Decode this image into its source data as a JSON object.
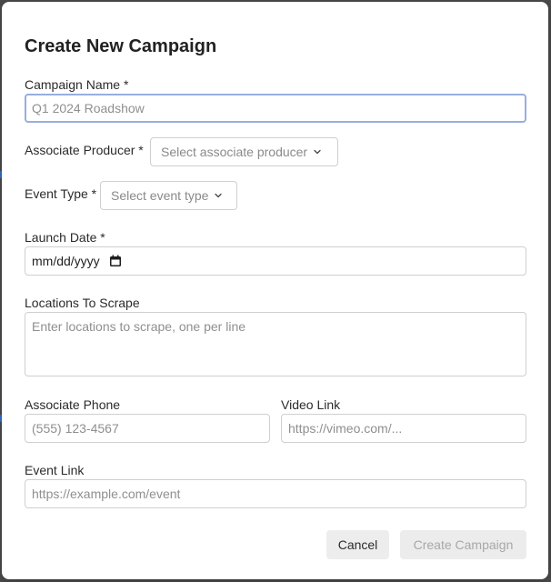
{
  "modal": {
    "title": "Create New Campaign"
  },
  "fields": {
    "campaign_name": {
      "label": "Campaign Name *",
      "placeholder": "Q1 2024 Roadshow"
    },
    "associate_producer": {
      "label": "Associate Producer *",
      "placeholder": "Select associate producer"
    },
    "event_type": {
      "label": "Event Type *",
      "placeholder": "Select event type"
    },
    "launch_date": {
      "label": "Launch Date *",
      "value": "mm/dd/yyyy"
    },
    "locations": {
      "label": "Locations To Scrape",
      "placeholder": "Enter locations to scrape, one per line"
    },
    "associate_phone": {
      "label": "Associate Phone",
      "placeholder": "(555) 123-4567"
    },
    "video_link": {
      "label": "Video Link",
      "placeholder": "https://vimeo.com/..."
    },
    "event_link": {
      "label": "Event Link",
      "placeholder": "https://example.com/event"
    }
  },
  "actions": {
    "cancel_label": "Cancel",
    "create_label": "Create Campaign"
  },
  "colors": {
    "focus_border": "#98aede",
    "disabled_text": "#a8a8a8",
    "backdrop": "#4b4b4b"
  },
  "icons": {
    "chevron": "chevron-down-icon",
    "calendar": "calendar-icon"
  }
}
